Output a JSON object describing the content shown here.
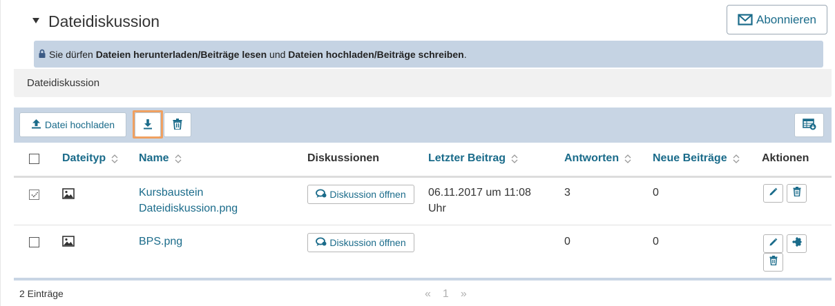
{
  "header": {
    "title": "Dateidiskussion",
    "subscribe_label": "Abonnieren"
  },
  "info": {
    "prefix": "Sie dürfen ",
    "perm_read": "Dateien herunterladen/Beiträge lesen",
    "middle": " und ",
    "perm_write": "Dateien hochladen/Beiträge schreiben",
    "suffix": "."
  },
  "subtitle": "Dateidiskussion",
  "toolbar": {
    "upload_label": "Datei hochladen",
    "icons": [
      "upload-icon",
      "download-icon",
      "trash-icon",
      "export-table-icon"
    ]
  },
  "table": {
    "columns": [
      {
        "label": "Dateityp",
        "sortable": true
      },
      {
        "label": "Name",
        "sortable": true
      },
      {
        "label": "Diskussionen",
        "sortable": false
      },
      {
        "label": "Letzter Beitrag",
        "sortable": true
      },
      {
        "label": "Antworten",
        "sortable": true
      },
      {
        "label": "Neue Beiträge",
        "sortable": true
      },
      {
        "label": "Aktionen",
        "sortable": false
      }
    ],
    "rows": [
      {
        "checked": true,
        "filetype_icon": "image-icon",
        "name_line1": "Kursbaustein",
        "name_line2": "Dateidiskussion.png",
        "discussion_label": "Diskussion öffnen",
        "last_post_line1": "06.11.2017 um 11:08",
        "last_post_line2": "Uhr",
        "replies": "3",
        "new_posts": "0",
        "actions": [
          "edit-icon",
          "trash-icon"
        ]
      },
      {
        "checked": false,
        "filetype_icon": "image-icon",
        "name_line1": "BPS.png",
        "discussion_label": "Diskussion öffnen",
        "replies": "0",
        "new_posts": "0",
        "actions": [
          "edit-icon",
          "puzzle-icon",
          "trash-icon"
        ]
      }
    ]
  },
  "footer": {
    "entries": "2 Einträge",
    "pager_prev": "«",
    "pager_page": "1",
    "pager_next": "»"
  },
  "colors": {
    "link": "#1a6b8a",
    "info_bg": "#c5d3e3",
    "toolbar_bg": "#c8d5e4",
    "highlight": "#f0a060"
  }
}
